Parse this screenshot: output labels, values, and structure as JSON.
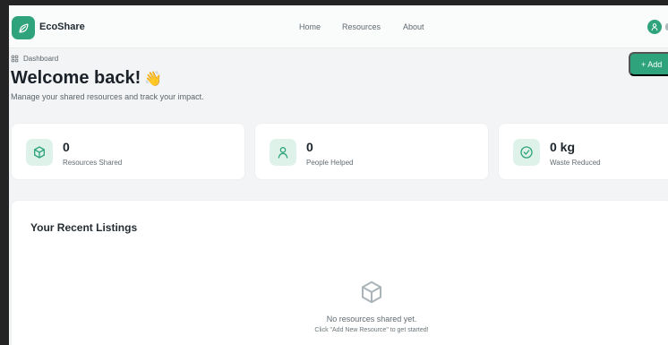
{
  "brand": {
    "name": "EcoShare",
    "logo_icon": "leaf-icon",
    "accent_color": "#2fa37c"
  },
  "nav": {
    "links": [
      "Home",
      "Resources",
      "About"
    ],
    "user_icon": "user-icon"
  },
  "breadcrumb": {
    "icon": "dashboard-grid-icon",
    "label": "Dashboard"
  },
  "header": {
    "title": "Welcome back!",
    "title_emoji": "👋",
    "subtitle": "Manage your shared resources and track your impact.",
    "action_label": "+ Add"
  },
  "stats": [
    {
      "icon": "box-icon",
      "value": "0",
      "label": "Resources Shared"
    },
    {
      "icon": "user-icon",
      "value": "0",
      "label": "People Helped"
    },
    {
      "icon": "check-circle-icon",
      "value": "0 kg",
      "label": "Waste Reduced"
    }
  ],
  "listings": {
    "title": "Your Recent Listings",
    "empty_icon": "box-icon",
    "empty_primary": "No resources shared yet.",
    "empty_secondary": "Click \"Add New Resource\" to get started!"
  }
}
